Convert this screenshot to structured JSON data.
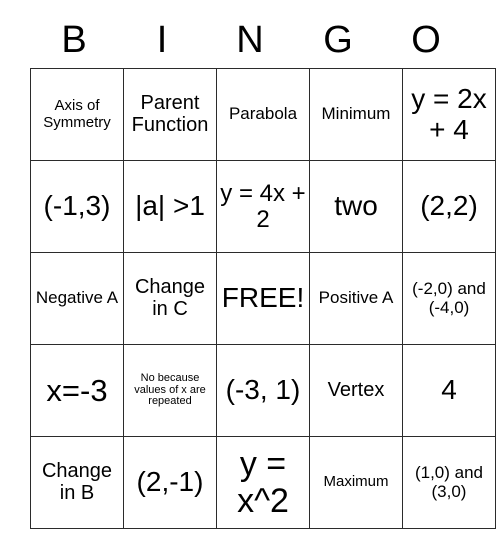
{
  "card": {
    "title_letters": [
      "B",
      "I",
      "N",
      "G",
      "O"
    ],
    "free_space_label": "FREE!",
    "colors": {
      "background": "#ffffff",
      "cell_background": "#ffffff",
      "border": "#2b2b2b",
      "text": "#000000"
    },
    "rows": [
      [
        {
          "text": "Axis of Symmetry",
          "size": "fs-sm"
        },
        {
          "text": "Parent Function",
          "size": "fs-lg"
        },
        {
          "text": "Parabola",
          "size": "fs-md"
        },
        {
          "text": "Minimum",
          "size": "fs-md"
        },
        {
          "text": "y = 2x + 4",
          "size": "fs-2xl"
        }
      ],
      [
        {
          "text": "(-1,3)",
          "size": "fs-2xl"
        },
        {
          "text": "|a| >1",
          "size": "fs-2xl"
        },
        {
          "text": "y = 4x + 2",
          "size": "fs-xl"
        },
        {
          "text": "two",
          "size": "fs-2xl"
        },
        {
          "text": "(2,2)",
          "size": "fs-2xl"
        }
      ],
      [
        {
          "text": "Negative A",
          "size": "fs-md"
        },
        {
          "text": "Change in C",
          "size": "fs-lg"
        },
        {
          "text": "FREE!",
          "size": "fs-2xl"
        },
        {
          "text": "Positive A",
          "size": "fs-md"
        },
        {
          "text": "(-2,0) and (-4,0)",
          "size": "fs-md"
        }
      ],
      [
        {
          "text": "x=-3",
          "size": "fs-3xl"
        },
        {
          "text": "No because values of x are repeated",
          "size": "fs-xs"
        },
        {
          "text": "(-3, 1)",
          "size": "fs-2xl"
        },
        {
          "text": "Vertex",
          "size": "fs-lg"
        },
        {
          "text": "4",
          "size": "fs-2xl"
        }
      ],
      [
        {
          "text": "Change in B",
          "size": "fs-lg"
        },
        {
          "text": "(2,-1)",
          "size": "fs-2xl"
        },
        {
          "text": "y = x^2",
          "size": "fs-4xl"
        },
        {
          "text": "Maximum",
          "size": "fs-sm"
        },
        {
          "text": "(1,0) and (3,0)",
          "size": "fs-md"
        }
      ]
    ]
  }
}
